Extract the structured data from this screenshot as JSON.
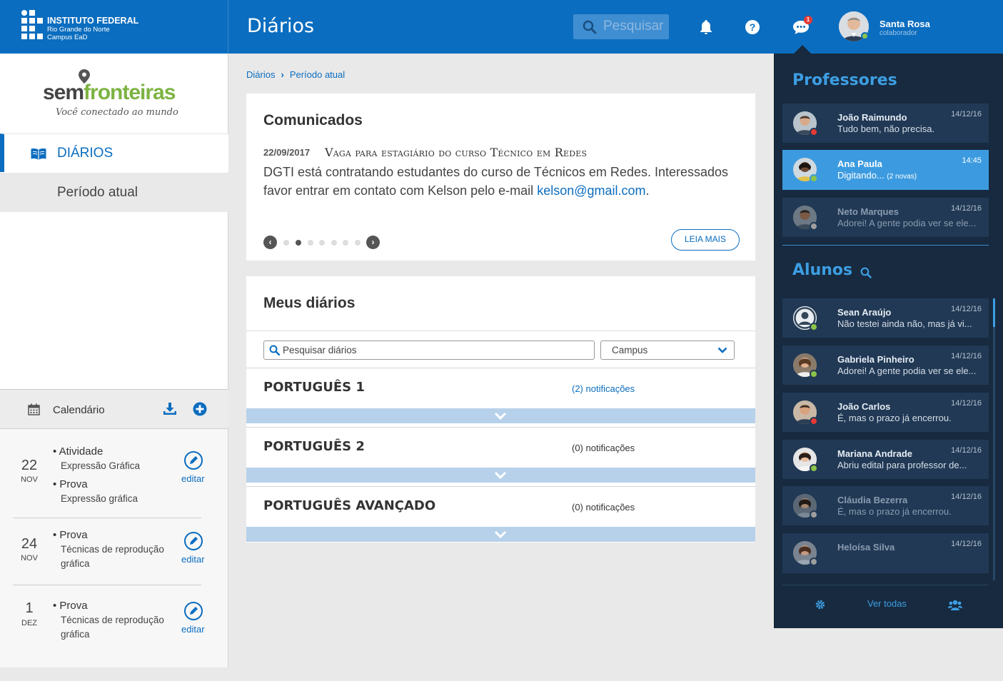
{
  "brand": {
    "line1": "INSTITUTO FEDERAL",
    "line2": "Rio Grande do Norte",
    "line3": "Campus EaD"
  },
  "header": {
    "title": "Diários",
    "search_placeholder": "Pesquisar",
    "chat_badge": "1"
  },
  "user": {
    "name": "Santa Rosa",
    "role": "colaborador"
  },
  "sidebar": {
    "logo_sem": "sem",
    "logo_fronteiras": "fronteiras",
    "logo_tagline": "Você conectado ao mundo",
    "nav_diarios": "DIÁRIOS",
    "nav_periodo": "Período atual"
  },
  "calendar": {
    "title": "Calendário",
    "items": [
      {
        "day": "22",
        "month": "NOV",
        "entries": [
          {
            "type": "• Atividade",
            "desc": "Expressão Gráfica"
          },
          {
            "type": "• Prova",
            "desc": "Expressão gráfica"
          }
        ],
        "edit": "editar"
      },
      {
        "day": "24",
        "month": "NOV",
        "entries": [
          {
            "type": "• Prova",
            "desc": "Técnicas de reprodução gráfica"
          }
        ],
        "edit": "editar"
      },
      {
        "day": "1",
        "month": "DEZ",
        "entries": [
          {
            "type": "• Prova",
            "desc": "Técnicas de reprodução gráfica"
          }
        ],
        "edit": "editar"
      }
    ]
  },
  "breadcrumb": {
    "root": "Diários",
    "current": "Período atual"
  },
  "comunicados": {
    "title": "Comunicados",
    "date": "22/09/2017",
    "headline": "Vaga para estagiário do curso Técnico em Redes",
    "body": "DGTI está contratando estudantes do curso de Técnicos em Redes. Interessados favor entrar em contato com Kelson pelo e-mail ",
    "email": "kelson@gmail.com",
    "body_end": ".",
    "read_more": "LEIA MAIS",
    "active_dot": 1,
    "dot_count": 7
  },
  "diarios": {
    "title": "Meus diários",
    "search_placeholder": "Pesquisar diários",
    "campus_label": "Campus",
    "courses": [
      {
        "name": "PORTUGUÊS 1",
        "notifications": "(2) notificações",
        "highlight": true
      },
      {
        "name": "PORTUGUÊS 2",
        "notifications": "(0) notificações",
        "highlight": false
      },
      {
        "name": "PORTUGUÊS AVANÇADO",
        "notifications": "(0) notificações",
        "highlight": false
      }
    ]
  },
  "chat": {
    "professors_title": "Professores",
    "students_title": "Alunos",
    "see_all": "Ver todas",
    "professors": [
      {
        "name": "João Raimundo",
        "msg": "Tudo bem, não precisa.",
        "time": "14/12/16",
        "status": "busy"
      },
      {
        "name": "Ana Paula",
        "msg": "Digitando... ",
        "extra": "(2 novas)",
        "time": "14:45",
        "status": "on",
        "active": true
      },
      {
        "name": "Neto Marques",
        "msg": "Adorei! A gente podia ver se ele...",
        "time": "14/12/16",
        "status": "off",
        "dim": true
      }
    ],
    "students": [
      {
        "name": "Sean Araújo",
        "msg": "Não testei ainda não, mas já vi...",
        "time": "14/12/16",
        "status": "on"
      },
      {
        "name": "Gabriela Pinheiro",
        "msg": "Adorei! A gente podia ver se ele...",
        "time": "14/12/16",
        "status": "on"
      },
      {
        "name": "João Carlos",
        "msg": "É, mas o prazo já encerrou.",
        "time": "14/12/16",
        "status": "busy"
      },
      {
        "name": "Mariana Andrade",
        "msg": "Abriu edital para professor de...",
        "time": "14/12/16",
        "status": "on"
      },
      {
        "name": "Cláudia Bezerra",
        "msg": "É, mas o prazo já encerrou.",
        "time": "14/12/16",
        "status": "off",
        "dim": true
      },
      {
        "name": "Heloísa Silva",
        "msg": "",
        "time": "14/12/16",
        "status": "off",
        "dim": true
      }
    ]
  },
  "colors": {
    "primary": "#0b6dbf",
    "chat_bg": "#172a3f",
    "chat_accent": "#3d9ee3",
    "online": "#8bc34a",
    "busy": "#e53935"
  }
}
